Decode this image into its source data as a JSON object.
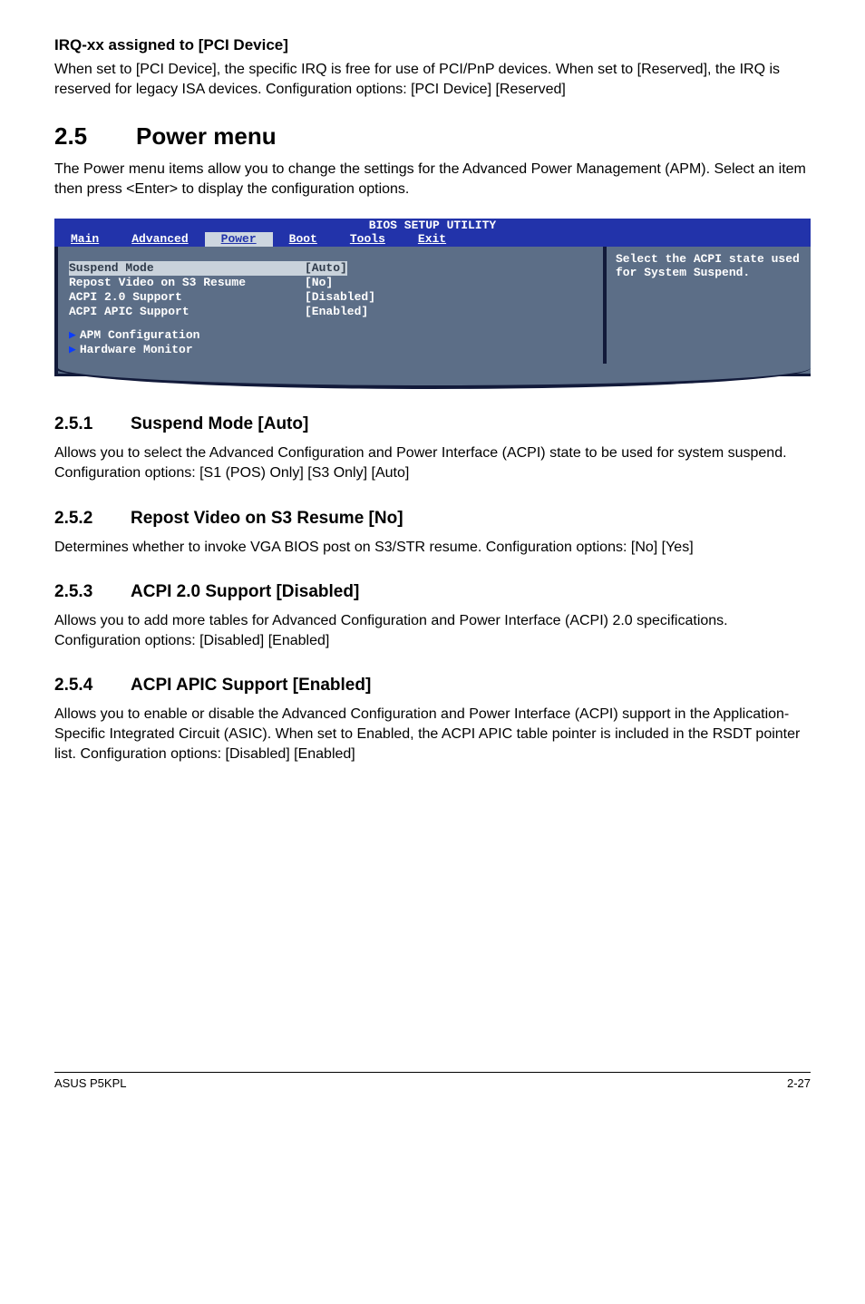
{
  "sec_irq": {
    "heading": "IRQ-xx assigned to [PCI Device]",
    "p1": "When set to [PCI Device], the specific IRQ is free for use of PCI/PnP devices. When set to [Reserved], the IRQ is reserved for legacy ISA devices. Configuration options: [PCI Device] [Reserved]"
  },
  "sec_25": {
    "num": "2.5",
    "title": "Power menu",
    "p1": "The Power menu items allow you to change the settings for the Advanced Power Management (APM). Select an item then press <Enter> to display the configuration options."
  },
  "bios": {
    "title": "BIOS SETUP UTILITY",
    "tabs": {
      "main": "Main",
      "advanced": "Advanced",
      "power": "Power",
      "boot": "Boot",
      "tools": "Tools",
      "exit": "Exit"
    },
    "rows": {
      "suspend_label": "Suspend Mode",
      "suspend_val": "[Auto]",
      "repost_label": "Repost Video on S3 Resume",
      "repost_val": "[No]",
      "acpi20_label": "ACPI 2.0 Support",
      "acpi20_val": "[Disabled]",
      "apic_label": "ACPI APIC Support",
      "apic_val": "[Enabled]"
    },
    "subs": {
      "apm": "APM Configuration",
      "hw": "Hardware Monitor"
    },
    "help": "Select the ACPI state used for System Suspend."
  },
  "sec_251": {
    "num": "2.5.1",
    "title": "Suspend Mode [Auto]",
    "p1": "Allows you to select the Advanced Configuration and Power Interface (ACPI) state to be used for system suspend.",
    "p2": "Configuration options: [S1 (POS) Only] [S3 Only] [Auto]"
  },
  "sec_252": {
    "num": "2.5.2",
    "title": "Repost Video on S3 Resume [No]",
    "p1": "Determines whether to invoke VGA BIOS post on S3/STR resume. Configuration options: [No] [Yes]"
  },
  "sec_253": {
    "num": "2.5.3",
    "title": "ACPI 2.0 Support [Disabled]",
    "p1": "Allows you to add more tables for Advanced Configuration and Power Interface (ACPI) 2.0 specifications. Configuration options: [Disabled] [Enabled]"
  },
  "sec_254": {
    "num": "2.5.4",
    "title": "ACPI APIC Support [Enabled]",
    "p1": "Allows you to enable or disable the Advanced Configuration and Power Interface (ACPI) support in the Application-Specific Integrated Circuit (ASIC). When set to Enabled, the ACPI APIC table pointer is included in the RSDT pointer list. Configuration options: [Disabled] [Enabled]"
  },
  "footer": {
    "left": "ASUS P5KPL",
    "right": "2-27"
  }
}
